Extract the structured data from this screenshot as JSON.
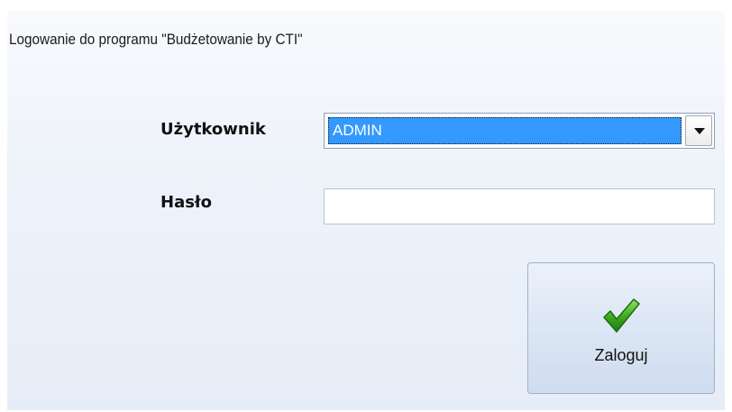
{
  "dialog": {
    "title": "Logowanie do programu \"Budżetowanie by CTI\""
  },
  "form": {
    "user_label": "Użytkownik",
    "user_value": "ADMIN",
    "password_label": "Hasło",
    "password_value": ""
  },
  "login_button": {
    "label": "Zaloguj",
    "icon": "check-icon"
  },
  "colors": {
    "selection": "#3399ff",
    "check_green": "#2e9a1e",
    "background": "#eef3fa"
  }
}
